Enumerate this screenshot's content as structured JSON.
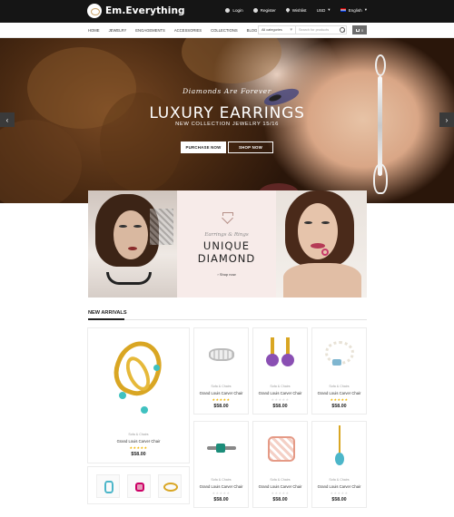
{
  "header": {
    "brand": "Em.Everything",
    "links": {
      "login": "Login",
      "register": "Register",
      "wishlist": "Wishlist",
      "currency": "USD",
      "language": "English"
    }
  },
  "nav": {
    "items": [
      "Home",
      "Jewelry",
      "Engagements",
      "Accessories",
      "Collections",
      "Blog"
    ],
    "category_select": "All categories",
    "search_placeholder": "Search for products",
    "cart_count": "0"
  },
  "hero": {
    "subtitle": "Diamonds Are Forever",
    "title": "LUXURY EARRINGS",
    "tagline": "NEW COLLECTION JEWELRY 15/16",
    "btn_purchase": "PURCHASE NOW",
    "btn_shop": "SHOP NOW",
    "prev": "‹",
    "next": "›"
  },
  "promo": {
    "subtitle": "Earrings & Rings",
    "title_line1": "UNIQUE",
    "title_line2": "DIAMOND",
    "link": "› Shop now"
  },
  "new_arrivals": {
    "title": "NEW ARRIVALS",
    "featured": {
      "category": "Sofa & Chairs",
      "name": "Grand Louis Carver Chair",
      "price": "$58.00",
      "rating": 5
    },
    "products": [
      {
        "category": "Sofa & Chairs",
        "name": "Grand Louis Carver Chair",
        "price": "$58.00",
        "rating": 5
      },
      {
        "category": "Sofa & Chairs",
        "name": "Grand Louis Carver Chair",
        "price": "$58.00",
        "rating": 0
      },
      {
        "category": "Sofa & Chairs",
        "name": "Grand Louis Carver Chair",
        "price": "$58.00",
        "rating": 5
      },
      {
        "category": "Sofa & Chairs",
        "name": "Grand Louis Carver Chair",
        "price": "$58.00",
        "rating": 0
      },
      {
        "category": "Sofa & Chairs",
        "name": "Grand Louis Carver Chair",
        "price": "$58.00",
        "rating": 0
      },
      {
        "category": "Sofa & Chairs",
        "name": "Grand Louis Carver Chair",
        "price": "$58.00",
        "rating": 0
      }
    ]
  },
  "colors": {
    "topbar": "#151515",
    "stars": "#f0b400",
    "promo_bg": "#f7ebe9"
  }
}
